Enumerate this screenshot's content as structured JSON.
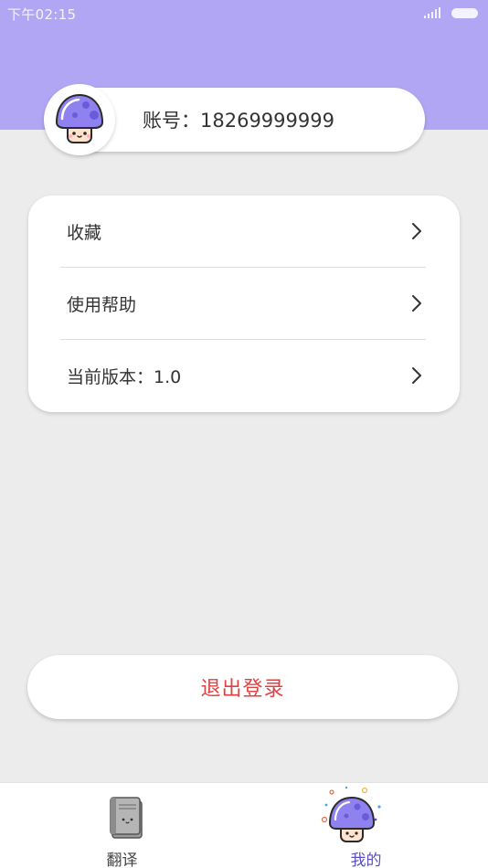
{
  "status_bar": {
    "time": "下午02:15"
  },
  "account": {
    "text": "账号：18269999999"
  },
  "menu": [
    {
      "label": "收藏"
    },
    {
      "label": "使用帮助"
    },
    {
      "label": "当前版本：1.0"
    }
  ],
  "logout": {
    "label": "退出登录"
  },
  "tabs": [
    {
      "label": "翻译",
      "icon": "book-icon",
      "active": false
    },
    {
      "label": "我的",
      "icon": "mushroom-icon",
      "active": true
    }
  ],
  "colors": {
    "header": "#b1a6f3",
    "accent": "#5a4fc6",
    "logout_text": "#e04040",
    "background": "#ececec"
  }
}
